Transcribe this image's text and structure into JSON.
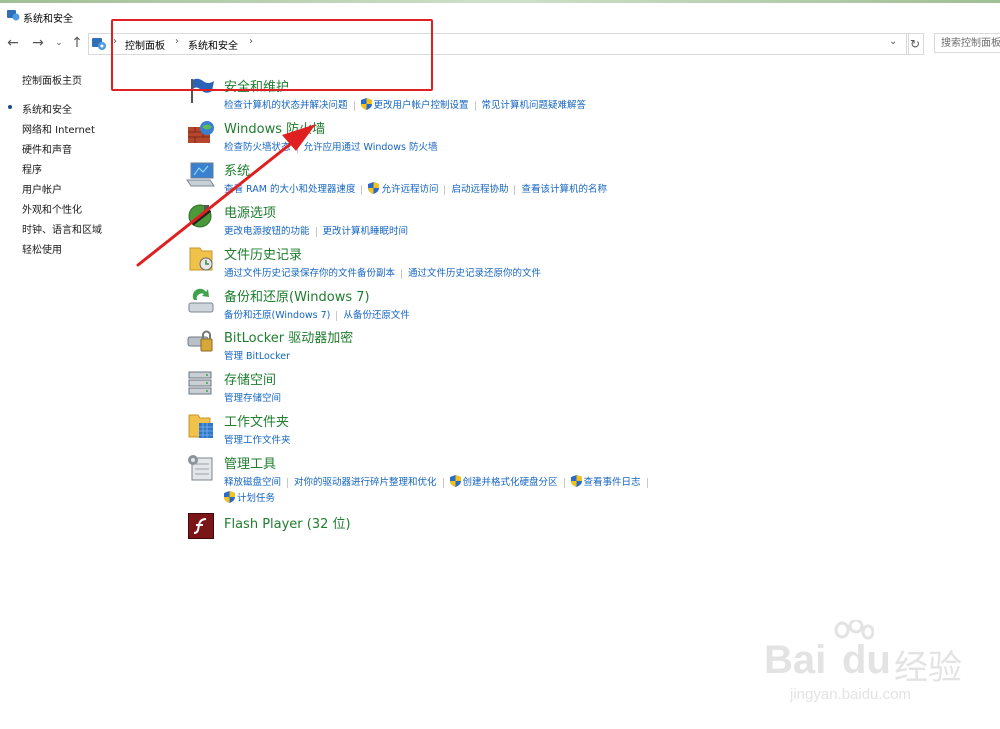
{
  "window": {
    "title": "系统和安全"
  },
  "address": {
    "crumbs": [
      "控制面板",
      "系统和安全"
    ],
    "search_placeholder": "搜索控制面板"
  },
  "sidebar": {
    "home": "控制面板主页",
    "items": [
      {
        "label": "系统和安全",
        "active": true
      },
      {
        "label": "网络和 Internet"
      },
      {
        "label": "硬件和声音"
      },
      {
        "label": "程序"
      },
      {
        "label": "用户帐户"
      },
      {
        "label": "外观和个性化"
      },
      {
        "label": "时钟、语言和区域"
      },
      {
        "label": "轻松使用"
      }
    ]
  },
  "categories": [
    {
      "title": "安全和维护",
      "icon": "flag-icon",
      "links": [
        {
          "label": "检查计算机的状态并解决问题"
        },
        {
          "label": "更改用户帐户控制设置",
          "shield": true
        },
        {
          "label": "常见计算机问题疑难解答"
        }
      ]
    },
    {
      "title": "Windows 防火墙",
      "icon": "firewall-icon",
      "links": [
        {
          "label": "检查防火墙状态"
        },
        {
          "label": "允许应用通过 Windows 防火墙"
        }
      ]
    },
    {
      "title": "系统",
      "icon": "monitor-icon",
      "links": [
        {
          "label": "查看 RAM 的大小和处理器速度"
        },
        {
          "label": "允许远程访问",
          "shield": true
        },
        {
          "label": "启动远程协助"
        },
        {
          "label": "查看该计算机的名称"
        }
      ]
    },
    {
      "title": "电源选项",
      "icon": "power-icon",
      "links": [
        {
          "label": "更改电源按钮的功能"
        },
        {
          "label": "更改计算机睡眠时间"
        }
      ]
    },
    {
      "title": "文件历史记录",
      "icon": "file-history-icon",
      "links": [
        {
          "label": "通过文件历史记录保存你的文件备份副本"
        },
        {
          "label": "通过文件历史记录还原你的文件"
        }
      ]
    },
    {
      "title": "备份和还原(Windows 7)",
      "icon": "backup-icon",
      "links": [
        {
          "label": "备份和还原(Windows 7)"
        },
        {
          "label": "从备份还原文件"
        }
      ]
    },
    {
      "title": "BitLocker 驱动器加密",
      "icon": "bitlocker-icon",
      "links": [
        {
          "label": "管理 BitLocker"
        }
      ]
    },
    {
      "title": "存储空间",
      "icon": "storage-icon",
      "links": [
        {
          "label": "管理存储空间"
        }
      ]
    },
    {
      "title": "工作文件夹",
      "icon": "work-folders-icon",
      "links": [
        {
          "label": "管理工作文件夹"
        }
      ]
    },
    {
      "title": "管理工具",
      "icon": "admin-tools-icon",
      "links": [
        {
          "label": "释放磁盘空间"
        },
        {
          "label": "对你的驱动器进行碎片整理和优化"
        },
        {
          "label": "创建并格式化硬盘分区",
          "shield": true
        },
        {
          "label": "查看事件日志",
          "shield": true
        }
      ],
      "links_row2": [
        {
          "label": "计划任务",
          "shield": true
        }
      ]
    },
    {
      "title": "Flash Player (32 位)",
      "icon": "flash-icon",
      "links": []
    }
  ],
  "watermark": {
    "brand": "Bai",
    "brand2": "du",
    "cn": "经验",
    "url": "jingyan.baidu.com"
  },
  "colors": {
    "link": "#1565c0",
    "title": "#1e7d2e",
    "annotation": "#e02020"
  }
}
